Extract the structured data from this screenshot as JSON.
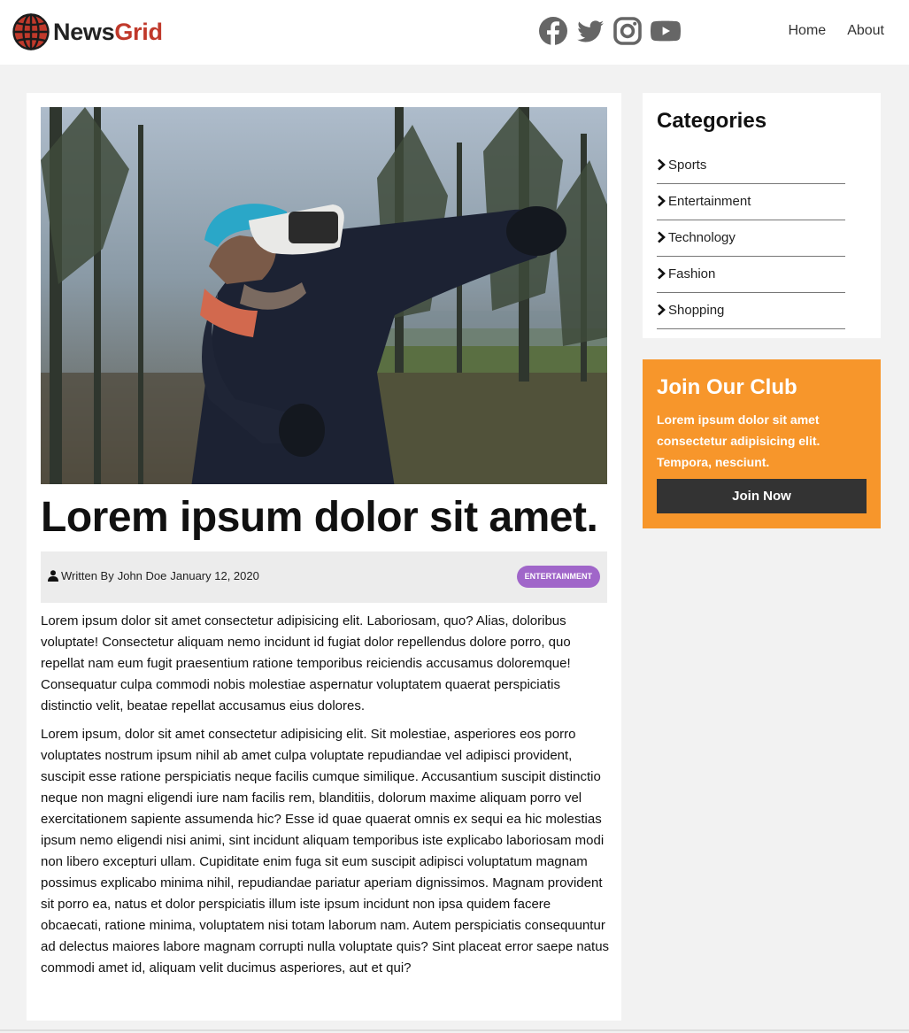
{
  "header": {
    "logo_part1": "News",
    "logo_part2": "Grid",
    "social_icons": [
      "facebook-icon",
      "twitter-icon",
      "instagram-icon",
      "youtube-icon"
    ],
    "nav": [
      {
        "label": "Home"
      },
      {
        "label": "About"
      }
    ]
  },
  "article": {
    "hero_icon": "vr-headset-runner-photo",
    "title": "Lorem ipsum dolor sit amet.",
    "author_prefix": "Written By",
    "author": "John Doe",
    "date": "January 12, 2020",
    "category_badge": "ENTERTAINMENT",
    "paragraphs": [
      "Lorem ipsum dolor sit amet consectetur adipisicing elit. Laboriosam, quo? Alias, doloribus voluptate! Consectetur aliquam nemo incidunt id fugiat dolor repellendus dolore porro, quo repellat nam eum fugit praesentium ratione temporibus reiciendis accusamus doloremque! Consequatur culpa commodi nobis molestiae aspernatur voluptatem quaerat perspiciatis distinctio velit, beatae repellat accusamus eius dolores.",
      "Lorem ipsum, dolor sit amet consectetur adipisicing elit. Sit molestiae, asperiores eos porro voluptates nostrum ipsum nihil ab amet culpa voluptate repudiandae vel adipisci provident, suscipit esse ratione perspiciatis neque facilis cumque similique. Accusantium suscipit distinctio neque non magni eligendi iure nam facilis rem, blanditiis, dolorum maxime aliquam porro vel exercitationem sapiente assumenda hic? Esse id quae quaerat omnis ex sequi ea hic molestias ipsum nemo eligendi nisi animi, sint incidunt aliquam temporibus iste explicabo laboriosam modi non libero excepturi ullam. Cupiditate enim fuga sit eum suscipit adipisci voluptatum magnam possimus explicabo minima nihil, repudiandae pariatur aperiam dignissimos. Magnam provident sit porro ea, natus et dolor perspiciatis illum iste ipsum incidunt non ipsa quidem facere obcaecati, ratione minima, voluptatem nisi totam laborum nam. Autem perspiciatis consequuntur ad delectus maiores labore magnam corrupti nulla voluptate quis? Sint placeat error saepe natus commodi amet id, aliquam velit ducimus asperiores, aut et qui?"
    ]
  },
  "sidebar": {
    "categories_title": "Categories",
    "categories": [
      {
        "label": "Sports"
      },
      {
        "label": "Entertainment"
      },
      {
        "label": "Technology"
      },
      {
        "label": "Fashion"
      },
      {
        "label": "Shopping"
      }
    ],
    "club": {
      "title": "Join Our Club",
      "text": "Lorem ipsum dolor sit amet consectetur adipisicing elit. Tempora, nesciunt.",
      "button": "Join Now"
    }
  },
  "colors": {
    "brand_red": "#c0392b",
    "club_orange": "#f7962b",
    "badge_purple": "#a066c9",
    "button_dark": "#333333"
  }
}
